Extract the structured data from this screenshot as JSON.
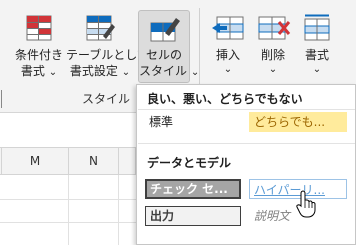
{
  "ribbon": {
    "conditional_formatting": {
      "line1": "条件付き",
      "line2": "書式"
    },
    "format_as_table": {
      "line1": "テーブルとして",
      "line2": "書式設定"
    },
    "cell_styles": {
      "line1": "セルの",
      "line2": "スタイル"
    },
    "insert": {
      "label": "挿入"
    },
    "delete": {
      "label": "削除"
    },
    "format": {
      "label": "書式"
    },
    "styles_group_label": "スタイル",
    "chevron": "⌄"
  },
  "sheet": {
    "columns": [
      "M",
      "N"
    ]
  },
  "cell_styles_menu": {
    "section_good_bad": "良い、悪い、どちらでもない",
    "section_data_model": "データとモデル",
    "styles": {
      "normal": "標準",
      "neutral": "どちらでも...",
      "check_cell": "チェック セ...",
      "hyperlink": "ハイパーリ...",
      "output": "出力",
      "explanatory": "説明文"
    },
    "colors": {
      "neutral_bg": "#ffeb9c",
      "neutral_text": "#9c6500",
      "check_bg": "#a5a5a5",
      "hyperlink_text": "#5b9bd5",
      "output_bg": "#f2f2f2",
      "explanatory_text": "#7f7f7f"
    }
  }
}
